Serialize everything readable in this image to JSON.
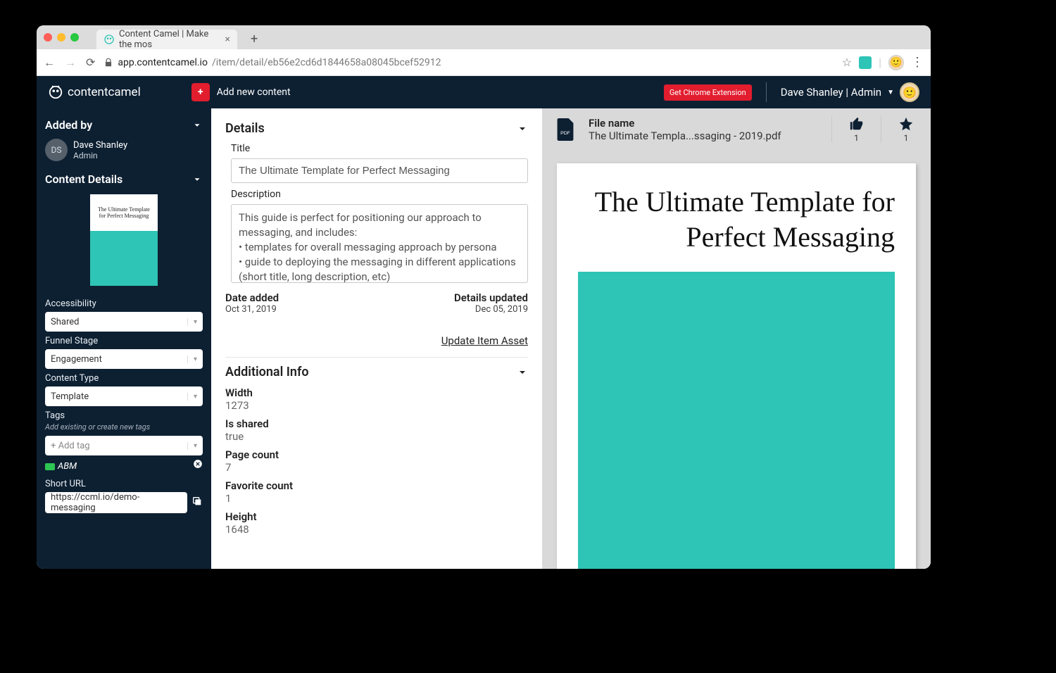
{
  "browser": {
    "tab_title": "Content Camel | Make the mos",
    "url_host": "app.contentcamel.io",
    "url_path": "/item/detail/eb56e2cd6d1844658a08045bcef52912"
  },
  "header": {
    "logo_text": "contentcamel",
    "add_btn": "Add new content",
    "ext_btn": "Get Chrome Extension",
    "user_label": "Dave Shanley | Admin"
  },
  "sidebar": {
    "added_by_header": "Added by",
    "user_initials": "DS",
    "user_name": "Dave Shanley",
    "user_role": "Admin",
    "content_details_header": "Content Details",
    "thumb_title": "The Ultimate Template for Perfect Messaging",
    "accessibility_label": "Accessibility",
    "accessibility_value": "Shared",
    "funnel_label": "Funnel Stage",
    "funnel_value": "Engagement",
    "content_type_label": "Content Type",
    "content_type_value": "Template",
    "tags_label": "Tags",
    "tags_hint": "Add existing or create new tags",
    "add_tag_placeholder": "+ Add tag",
    "tag_name": "ABM",
    "short_url_label": "Short URL",
    "short_url_value": "https://ccml.io/demo-messaging"
  },
  "details": {
    "section_title": "Details",
    "title_label": "Title",
    "title_value": "The Ultimate Template for Perfect Messaging",
    "description_label": "Description",
    "description_value": "This guide is perfect for positioning our approach to messaging, and includes:\n• templates for overall messaging approach by persona\n• guide to deploying the messaging in different applications (short title, long description, etc)",
    "date_added_label": "Date added",
    "date_added_value": "Oct 31, 2019",
    "details_updated_label": "Details updated",
    "details_updated_value": "Dec 05, 2019",
    "update_link": "Update Item Asset",
    "additional_info_title": "Additional Info",
    "info": {
      "width_label": "Width",
      "width_value": "1273",
      "isshared_label": "Is shared",
      "isshared_value": "true",
      "pagecount_label": "Page count",
      "pagecount_value": "7",
      "favcount_label": "Favorite count",
      "favcount_value": "1",
      "height_label": "Height",
      "height_value": "1648"
    }
  },
  "preview": {
    "file_name_label": "File name",
    "file_name_value": "The Ultimate Templa...ssaging - 2019.pdf",
    "like_count": "1",
    "star_count": "1",
    "page_title": "The Ultimate Template for Perfect Messaging"
  }
}
